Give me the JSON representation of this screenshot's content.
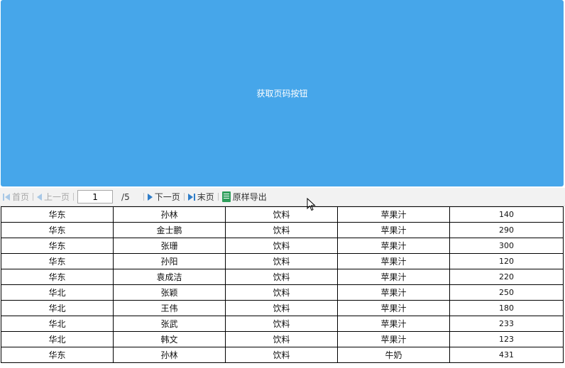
{
  "button": {
    "label": "获取页码按钮",
    "color": "#46a6ea"
  },
  "toolbar": {
    "first_label": "首页",
    "prev_label": "上一页",
    "page_value": "1",
    "total_pages": "/5",
    "next_label": "下一页",
    "last_label": "末页",
    "export_label": "原样导出"
  },
  "table": {
    "rows": [
      [
        "华东",
        "孙林",
        "饮料",
        "苹果汁",
        "140"
      ],
      [
        "华东",
        "金士鹏",
        "饮料",
        "苹果汁",
        "290"
      ],
      [
        "华东",
        "张珊",
        "饮料",
        "苹果汁",
        "300"
      ],
      [
        "华东",
        "孙阳",
        "饮料",
        "苹果汁",
        "120"
      ],
      [
        "华东",
        "袁成洁",
        "饮料",
        "苹果汁",
        "220"
      ],
      [
        "华北",
        "张颖",
        "饮料",
        "苹果汁",
        "250"
      ],
      [
        "华北",
        "王伟",
        "饮料",
        "苹果汁",
        "180"
      ],
      [
        "华北",
        "张武",
        "饮料",
        "苹果汁",
        "233"
      ],
      [
        "华北",
        "韩文",
        "饮料",
        "苹果汁",
        "123"
      ],
      [
        "华东",
        "孙林",
        "饮料",
        "牛奶",
        "431"
      ]
    ]
  }
}
